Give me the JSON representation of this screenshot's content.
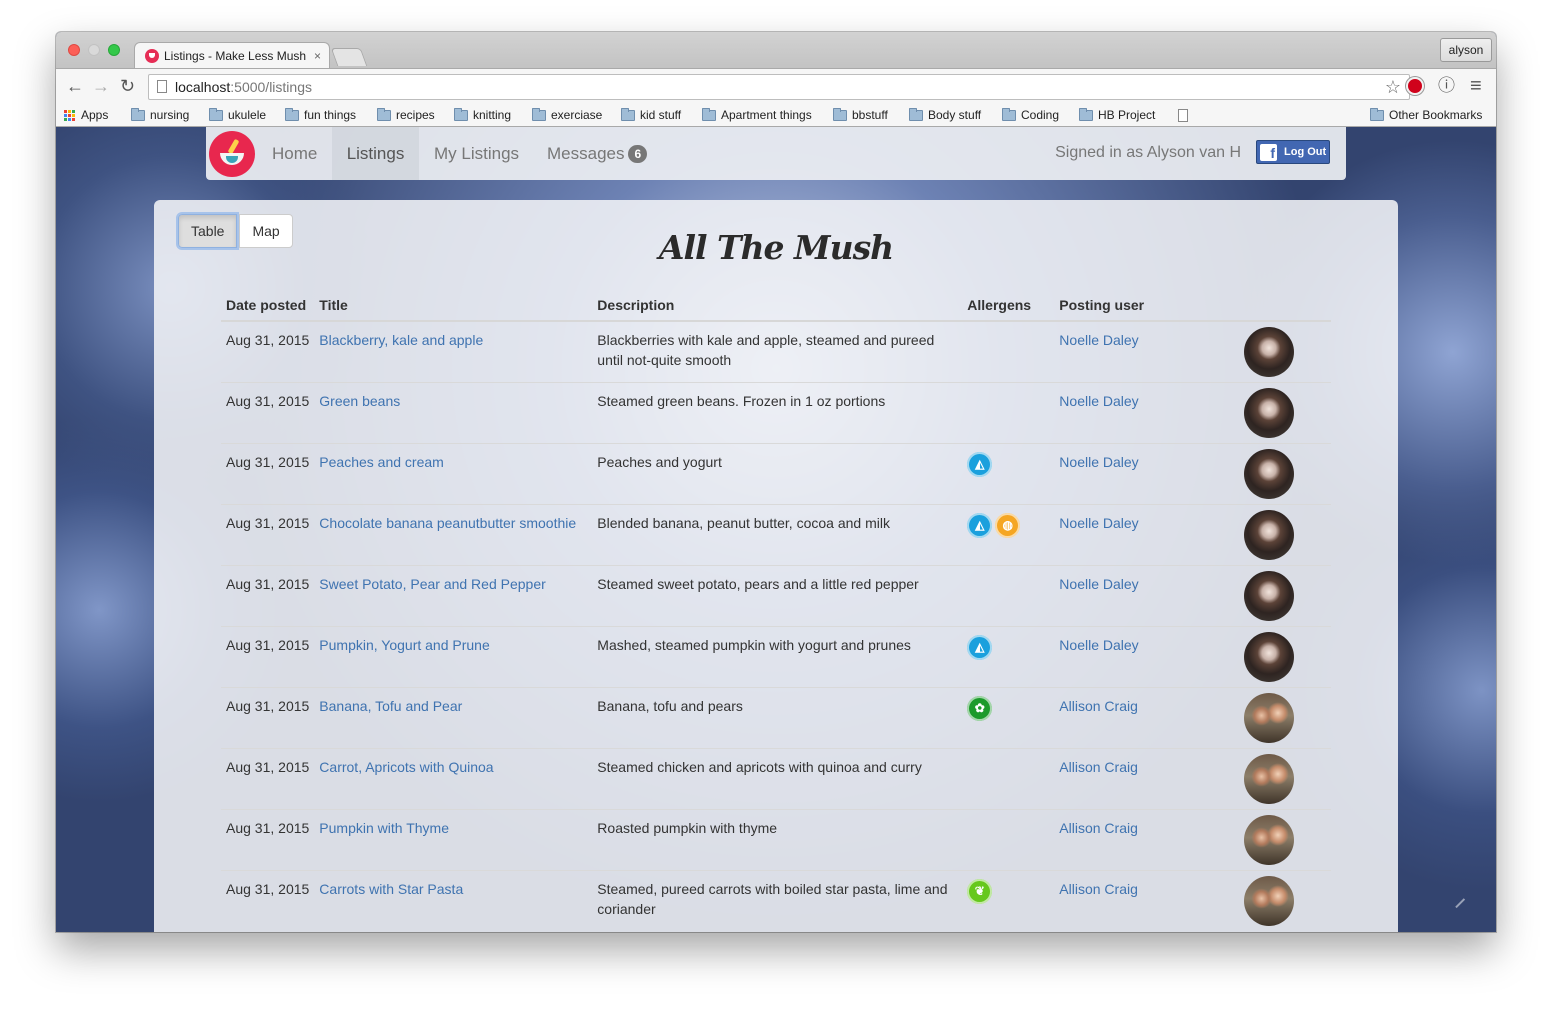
{
  "browser": {
    "tab_title": "Listings - Make Less Mush",
    "tab_close": "×",
    "profile_name": "alyson",
    "url_host": "localhost",
    "url_path": ":5000/listings",
    "bookmarks": [
      "Apps",
      "nursing",
      "ukulele",
      "fun things",
      "recipes",
      "knitting",
      "exerciase",
      "kid stuff",
      "Apartment things",
      "bbstuff",
      "Body stuff",
      "Coding",
      "HB Project"
    ],
    "other_bookmarks": "Other Bookmarks",
    "nav_back": "←",
    "nav_forward": "→",
    "nav_reload": "↻",
    "star": "☆",
    "menu": "≡",
    "info": "ⓘ"
  },
  "navbar": {
    "links": [
      "Home",
      "Listings",
      "My Listings",
      "Messages"
    ],
    "active": "Listings",
    "messages_count": "6",
    "signed_in": "Signed in as Alyson van H",
    "logout": "Log Out",
    "fb_letter": "f"
  },
  "view_toggle": {
    "table": "Table",
    "map": "Map",
    "selected": "Table"
  },
  "page_title": "All The Mush",
  "table": {
    "headers": [
      "Date posted",
      "Title",
      "Description",
      "Allergens",
      "Posting user"
    ],
    "rows": [
      {
        "date": "Aug 31, 2015",
        "title": "Blackberry, kale and apple",
        "description": "Blackberries with kale and apple, steamed and pureed until not-quite smooth",
        "allergens": [],
        "user": "Noelle Daley",
        "avatar": "noelle"
      },
      {
        "date": "Aug 31, 2015",
        "title": "Green beans",
        "description": "Steamed green beans. Frozen in 1 oz portions",
        "allergens": [],
        "user": "Noelle Daley",
        "avatar": "noelle"
      },
      {
        "date": "Aug 31, 2015",
        "title": "Peaches and cream",
        "description": "Peaches and yogurt",
        "allergens": [
          "dairy"
        ],
        "user": "Noelle Daley",
        "avatar": "noelle"
      },
      {
        "date": "Aug 31, 2015",
        "title": "Chocolate banana peanutbutter smoothie",
        "description": "Blended banana, peanut butter, cocoa and milk",
        "allergens": [
          "dairy",
          "peanut"
        ],
        "user": "Noelle Daley",
        "avatar": "noelle"
      },
      {
        "date": "Aug 31, 2015",
        "title": "Sweet Potato, Pear and Red Pepper",
        "description": "Steamed sweet potato, pears and a little red pepper",
        "allergens": [],
        "user": "Noelle Daley",
        "avatar": "noelle"
      },
      {
        "date": "Aug 31, 2015",
        "title": "Pumpkin, Yogurt and Prune",
        "description": "Mashed, steamed pumpkin with yogurt and prunes",
        "allergens": [
          "dairy"
        ],
        "user": "Noelle Daley",
        "avatar": "noelle"
      },
      {
        "date": "Aug 31, 2015",
        "title": "Banana, Tofu and Pear",
        "description": "Banana, tofu and pears",
        "allergens": [
          "soy"
        ],
        "user": "Allison Craig",
        "avatar": "allison"
      },
      {
        "date": "Aug 31, 2015",
        "title": "Carrot, Apricots with Quinoa",
        "description": "Steamed chicken and apricots with quinoa and curry",
        "allergens": [],
        "user": "Allison Craig",
        "avatar": "allison"
      },
      {
        "date": "Aug 31, 2015",
        "title": "Pumpkin with Thyme",
        "description": "Roasted pumpkin with thyme",
        "allergens": [],
        "user": "Allison Craig",
        "avatar": "allison"
      },
      {
        "date": "Aug 31, 2015",
        "title": "Carrots with Star Pasta",
        "description": "Steamed, pureed carrots with boiled star pasta, lime and coriander",
        "allergens": [
          "gluten"
        ],
        "user": "Allison Craig",
        "avatar": "allison"
      }
    ]
  },
  "colors": {
    "link": "#3f73b0",
    "logo": "#e8274e",
    "dairy": "#1aa0dd",
    "peanut": "#f5a623",
    "soy": "#1c9a2b",
    "gluten": "#66c81d",
    "facebook": "#4267b2"
  }
}
